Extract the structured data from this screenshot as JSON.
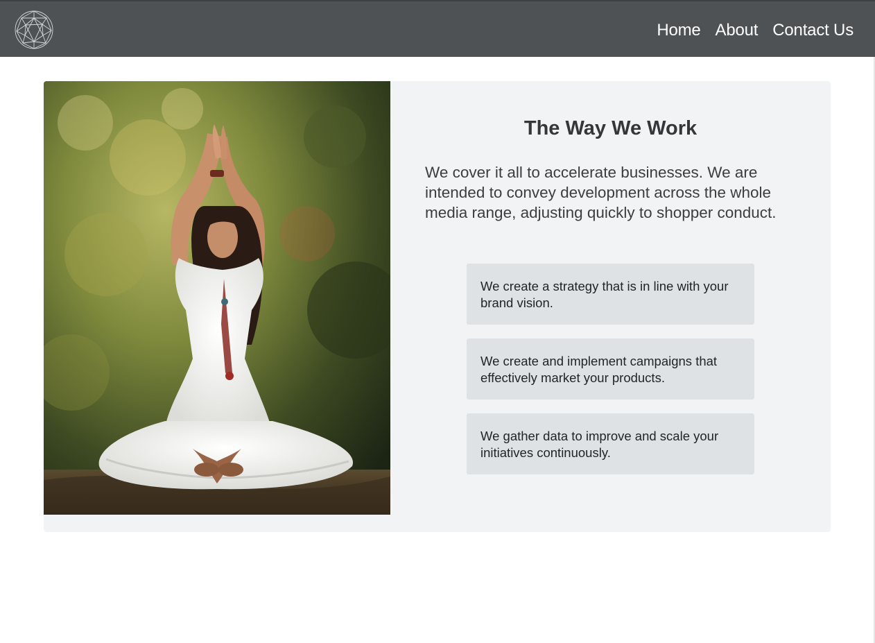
{
  "colors": {
    "navbar_bg": "#4f5254",
    "card_bg": "#f1f3f4",
    "feature_bg": "#dfe2e5",
    "text_dark": "#34363a"
  },
  "navbar": {
    "logo_icon": "geodesic-sphere-icon",
    "links": [
      {
        "label": "Home"
      },
      {
        "label": "About"
      },
      {
        "label": "Contact Us"
      }
    ]
  },
  "main": {
    "image": "photo of woman in white dress doing yoga pose in a forest",
    "title": "The Way We Work",
    "intro": "We cover it all to accelerate businesses. We are intended to convey development across the whole media range, adjusting quickly to shopper conduct.",
    "features": [
      {
        "text": "We create a strategy that is in line with your brand vision."
      },
      {
        "text": "We create and implement campaigns that effectively market your products."
      },
      {
        "text": "We gather data to improve and scale your initiatives continuously."
      }
    ]
  }
}
